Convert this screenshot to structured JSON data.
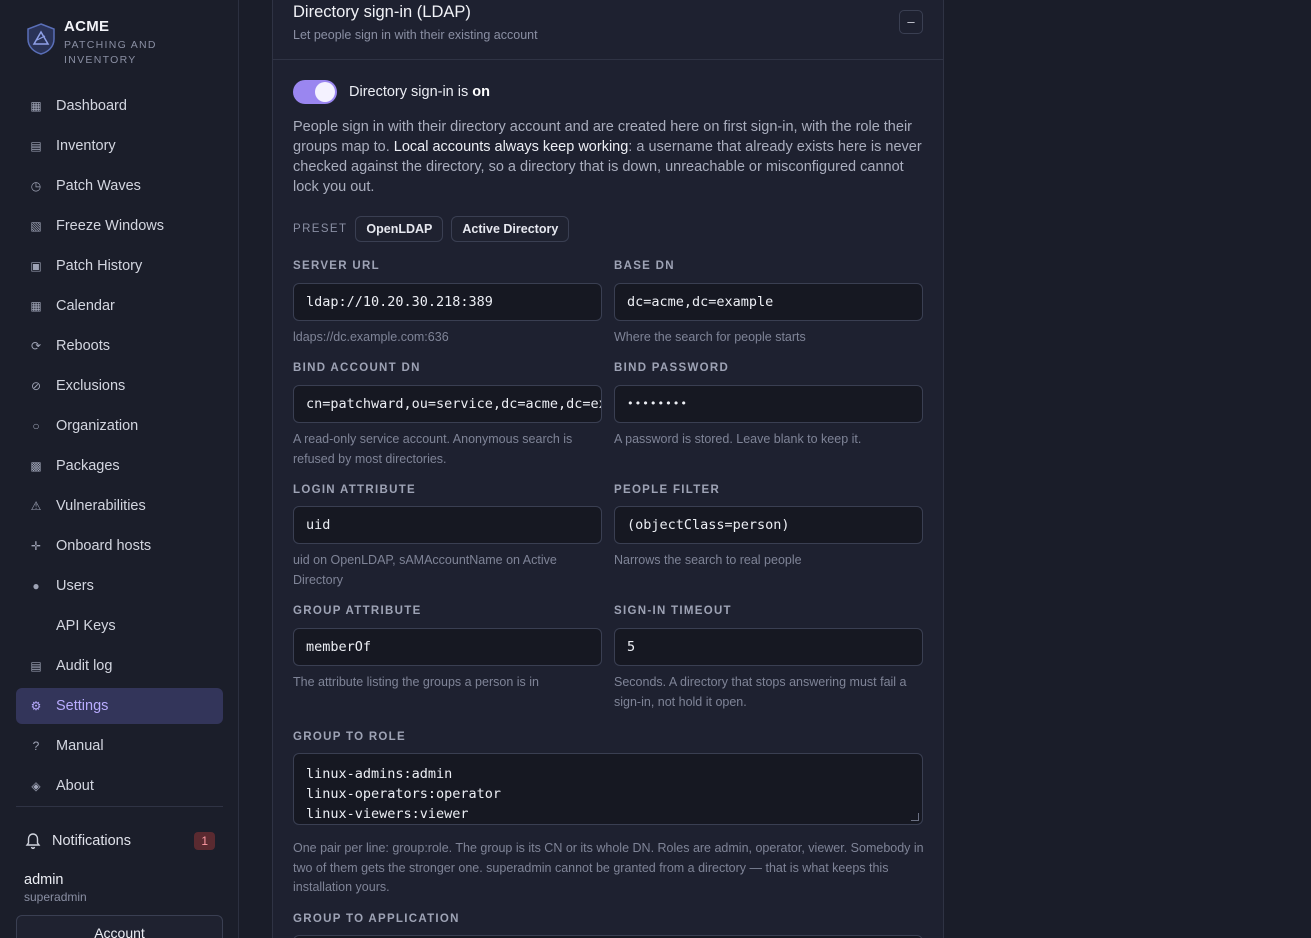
{
  "brand": {
    "name": "ACME",
    "subtitle": "PATCHING AND INVENTORY"
  },
  "nav": [
    {
      "label": "Dashboard",
      "icon": "dashboard-icon",
      "glyph": "▦"
    },
    {
      "label": "Inventory",
      "icon": "inventory-icon",
      "glyph": "▤"
    },
    {
      "label": "Patch Waves",
      "icon": "clock-icon",
      "glyph": "◷"
    },
    {
      "label": "Freeze Windows",
      "icon": "freeze-icon",
      "glyph": "▧"
    },
    {
      "label": "Patch History",
      "icon": "history-icon",
      "glyph": "▣"
    },
    {
      "label": "Calendar",
      "icon": "calendar-icon",
      "glyph": "▦"
    },
    {
      "label": "Reboots",
      "icon": "reboot-icon",
      "glyph": "⟳"
    },
    {
      "label": "Exclusions",
      "icon": "exclusion-icon",
      "glyph": "⊘"
    },
    {
      "label": "Organization",
      "icon": "organization-icon",
      "glyph": "○"
    },
    {
      "label": "Packages",
      "icon": "package-icon",
      "glyph": "▩"
    },
    {
      "label": "Vulnerabilities",
      "icon": "warning-icon",
      "glyph": "⚠"
    },
    {
      "label": "Onboard hosts",
      "icon": "plus-icon",
      "glyph": "✛"
    },
    {
      "label": "Users",
      "icon": "user-icon",
      "glyph": "●"
    },
    {
      "label": "API Keys",
      "icon": "key-icon",
      "glyph": ""
    },
    {
      "label": "Audit log",
      "icon": "log-icon",
      "glyph": "▤"
    },
    {
      "label": "Settings",
      "icon": "gear-icon",
      "glyph": "⚙",
      "active": true
    },
    {
      "label": "Manual",
      "icon": "help-icon",
      "glyph": "?"
    },
    {
      "label": "About",
      "icon": "about-icon",
      "glyph": "◈"
    }
  ],
  "notifications": {
    "label": "Notifications",
    "count": "1"
  },
  "user": {
    "name": "admin",
    "role": "superadmin"
  },
  "account_label": "Account",
  "section": {
    "title": "Directory sign-in (LDAP)",
    "subtitle": "Let people sign in with their existing account",
    "collapse_glyph": "–"
  },
  "toggle": {
    "label_prefix": "Directory sign-in is",
    "state": "on"
  },
  "intro": {
    "part1": "People sign in with their directory account and are created here on first sign-in, with the role their groups map to. ",
    "strong": "Local accounts always keep working",
    "part2": ": a username that already exists here is never checked against the directory, so a directory that is down, unreachable or misconfigured cannot lock you out."
  },
  "preset": {
    "label": "PRESET",
    "options": [
      "OpenLDAP",
      "Active Directory"
    ]
  },
  "fields": {
    "server_url": {
      "label": "SERVER URL",
      "value": "ldap://10.20.30.218:389",
      "help": "ldaps://dc.example.com:636"
    },
    "base_dn": {
      "label": "BASE DN",
      "value": "dc=acme,dc=example",
      "help": "Where the search for people starts"
    },
    "bind_dn": {
      "label": "BIND ACCOUNT DN",
      "value": "cn=patchward,ou=service,dc=acme,dc=example",
      "help": "A read-only service account. Anonymous search is refused by most directories."
    },
    "bind_password": {
      "label": "BIND PASSWORD",
      "value": "••••••••",
      "help": "A password is stored. Leave blank to keep it."
    },
    "login_attr": {
      "label": "LOGIN ATTRIBUTE",
      "value": "uid",
      "help": "uid on OpenLDAP, sAMAccountName on Active Directory"
    },
    "people_filter": {
      "label": "PEOPLE FILTER",
      "value": "(objectClass=person)",
      "help": "Narrows the search to real people"
    },
    "group_attr": {
      "label": "GROUP ATTRIBUTE",
      "value": "memberOf",
      "help": "The attribute listing the groups a person is in"
    },
    "timeout": {
      "label": "SIGN-IN TIMEOUT",
      "value": "5",
      "help": "Seconds. A directory that stops answering must fail a sign-in, not hold it open."
    }
  },
  "group_to_role": {
    "label": "GROUP TO ROLE",
    "lines": [
      "linux-admins:admin",
      "linux-operators:operator",
      "linux-viewers:viewer"
    ],
    "help": "One pair per line: group:role. The group is its CN or its whole DN. Roles are admin, operator, viewer. Somebody in two of them gets the stronger one. superadmin cannot be granted from a directory — that is what keeps this installation yours."
  },
  "group_to_app": {
    "label": "GROUP TO APPLICATION"
  },
  "colors": {
    "accent": "#9a86f0",
    "active_bg": "#33355a",
    "background": "#1a1d29"
  }
}
